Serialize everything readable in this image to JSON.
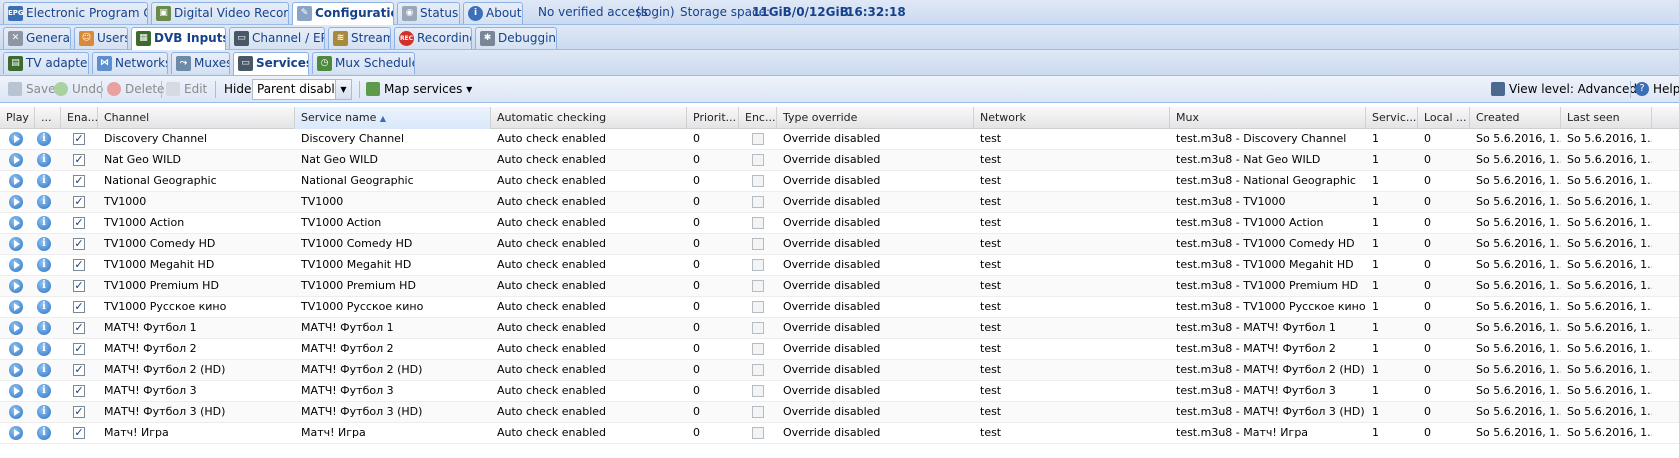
{
  "top_tabs": [
    {
      "label": "Electronic Program Guide",
      "icon": "epg-icon"
    },
    {
      "label": "Digital Video Recorder",
      "icon": "dvr-icon"
    },
    {
      "label": "Configuration",
      "icon": "wrench-icon"
    },
    {
      "label": "Status",
      "icon": "eye-icon"
    },
    {
      "label": "About",
      "icon": "info-icon"
    }
  ],
  "status": {
    "access": "No verified access",
    "login": "(login)",
    "storage_label": "Storage space:",
    "storage_value": "11GiB/0/12GiB",
    "time": "16:32:18"
  },
  "config_tabs": [
    {
      "label": "General",
      "icon": "tools-icon"
    },
    {
      "label": "Users",
      "icon": "users-icon"
    },
    {
      "label": "DVB Inputs",
      "icon": "dvb-icon"
    },
    {
      "label": "Channel / EPG",
      "icon": "tv-icon"
    },
    {
      "label": "Stream",
      "icon": "stream-icon"
    },
    {
      "label": "Recording",
      "icon": "rec-icon"
    },
    {
      "label": "Debugging",
      "icon": "bug-icon"
    }
  ],
  "dvb_tabs": [
    {
      "label": "TV adapters",
      "icon": "adapter-icon"
    },
    {
      "label": "Networks",
      "icon": "network-icon"
    },
    {
      "label": "Muxes",
      "icon": "mux-icon"
    },
    {
      "label": "Services",
      "icon": "services-icon"
    },
    {
      "label": "Mux Schedulers",
      "icon": "scheduler-icon"
    }
  ],
  "toolbar": {
    "save": "Save",
    "undo": "Undo",
    "delete": "Delete",
    "edit": "Edit",
    "hide_label": "Hide:",
    "hide_value": "Parent disabled",
    "map_services": "Map services",
    "view_level": "View level: Advanced",
    "help": "Help"
  },
  "columns": [
    "Play",
    "...",
    "Ena...",
    "Channel",
    "Service name",
    "Automatic checking",
    "Priorit...",
    "Enc...",
    "Type override",
    "Network",
    "Mux",
    "Servic...",
    "Local ...",
    "Created",
    "Last seen"
  ],
  "rows": [
    {
      "channel": "Discovery Channel",
      "service": "Discovery Channel",
      "mux": "test.m3u8 - Discovery Channel"
    },
    {
      "channel": "Nat Geo WILD",
      "service": "Nat Geo WILD",
      "mux": "test.m3u8 - Nat Geo WILD"
    },
    {
      "channel": "National Geographic",
      "service": "National Geographic",
      "mux": "test.m3u8 - National Geographic"
    },
    {
      "channel": "TV1000",
      "service": "TV1000",
      "mux": "test.m3u8 - TV1000"
    },
    {
      "channel": "TV1000 Action",
      "service": "TV1000 Action",
      "mux": "test.m3u8 - TV1000 Action"
    },
    {
      "channel": "TV1000 Comedy HD",
      "service": "TV1000 Comedy HD",
      "mux": "test.m3u8 - TV1000 Comedy HD"
    },
    {
      "channel": "TV1000 Megahit HD",
      "service": "TV1000 Megahit HD",
      "mux": "test.m3u8 - TV1000 Megahit HD"
    },
    {
      "channel": "TV1000 Premium HD",
      "service": "TV1000 Premium HD",
      "mux": "test.m3u8 - TV1000 Premium HD"
    },
    {
      "channel": "TV1000 Русское кино",
      "service": "TV1000 Русское кино",
      "mux": "test.m3u8 - TV1000 Русское кино"
    },
    {
      "channel": "МАТЧ! Футбол 1",
      "service": "МАТЧ! Футбол 1",
      "mux": "test.m3u8 - МАТЧ! Футбол 1"
    },
    {
      "channel": "МАТЧ! Футбол 2",
      "service": "МАТЧ! Футбол 2",
      "mux": "test.m3u8 - МАТЧ! Футбол 2"
    },
    {
      "channel": "МАТЧ! Футбол 2 (HD)",
      "service": "МАТЧ! Футбол 2 (HD)",
      "mux": "test.m3u8 - МАТЧ! Футбол 2 (HD)"
    },
    {
      "channel": "МАТЧ! Футбол 3",
      "service": "МАТЧ! Футбол 3",
      "mux": "test.m3u8 - МАТЧ! Футбол 3"
    },
    {
      "channel": "МАТЧ! Футбол 3 (HD)",
      "service": "МАТЧ! Футбол 3 (HD)",
      "mux": "test.m3u8 - МАТЧ! Футбол 3 (HD)"
    },
    {
      "channel": "Матч! Игра",
      "service": "Матч! Игра",
      "mux": "test.m3u8 - Матч! Игра"
    }
  ],
  "row_defaults": {
    "enabled": true,
    "auto_check": "Auto check enabled",
    "priority": "0",
    "encrypted": false,
    "type_override": "Override disabled",
    "network": "test",
    "service_id": "1",
    "local": "0",
    "created": "So 5.6.2016, 1...",
    "last_seen": "So 5.6.2016, 1..."
  }
}
